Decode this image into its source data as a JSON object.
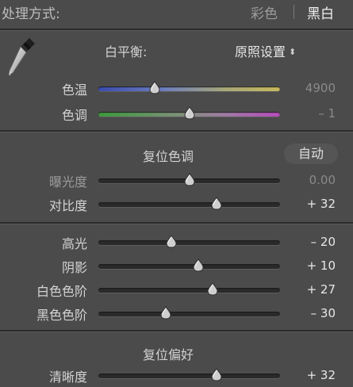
{
  "treatment": {
    "label": "处理方式:",
    "color_option": "彩色",
    "bw_option": "黑白",
    "selected": "黑白"
  },
  "white_balance": {
    "label": "白平衡:",
    "value": "原照设置",
    "eyedropper_icon": "eyedropper-icon",
    "temp": {
      "label": "色温",
      "value_text": "4900",
      "position": 0.31
    },
    "tint": {
      "label": "色调",
      "value_text": "– 1",
      "position": 0.5
    }
  },
  "tone": {
    "reset_label": "复位色调",
    "auto_label": "自动",
    "exposure": {
      "label": "曝光度",
      "value_text": "0.00",
      "position": 0.5
    },
    "contrast": {
      "label": "对比度",
      "value_text": "+ 32",
      "position": 0.65
    },
    "highlights": {
      "label": "高光",
      "value_text": "– 20",
      "position": 0.4
    },
    "shadows": {
      "label": "阴影",
      "value_text": "+ 10",
      "position": 0.55
    },
    "whites": {
      "label": "白色色阶",
      "value_text": "+ 27",
      "position": 0.63
    },
    "blacks": {
      "label": "黑色色阶",
      "value_text": "– 30",
      "position": 0.37
    }
  },
  "presence": {
    "reset_label": "复位偏好",
    "clarity": {
      "label": "清晰度",
      "value_text": "+ 32",
      "position": 0.65
    }
  },
  "colors": {
    "panel_bg": "#4b4b4b",
    "temp_gradient": [
      "#3b4bb0",
      "#c8b95a"
    ],
    "tint_gradient": [
      "#3d9a3d",
      "#b64cbc"
    ],
    "thumb": "#d0d0d0"
  }
}
